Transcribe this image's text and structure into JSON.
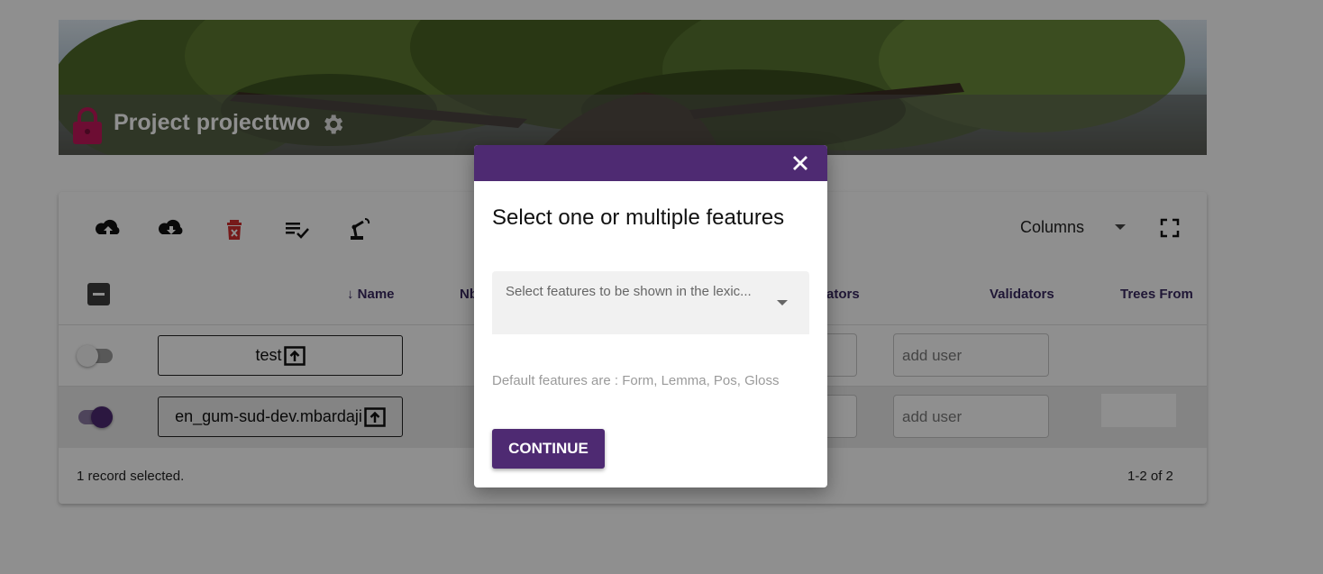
{
  "project": {
    "title": "Project projecttwo",
    "lock_icon": "lock-icon",
    "settings_icon": "gear-icon"
  },
  "toolbar": {
    "icons": [
      "cloud-upload-icon",
      "cloud-download-icon",
      "delete-icon",
      "playlist-check-icon",
      "robot-arm-icon"
    ],
    "columns_label": "Columns",
    "fullscreen_icon": "fullscreen-icon"
  },
  "table": {
    "headers": {
      "name": "Name",
      "nb": "Nb",
      "annotators_partial": "ators",
      "validators": "Validators",
      "trees_from": "Trees From"
    },
    "rows": [
      {
        "name": "test",
        "selected": false,
        "annotators_placeholder": "add user"
      },
      {
        "name": "en_gum-sud-dev.mbardaji",
        "selected": true,
        "annotators_placeholder": "add user"
      }
    ],
    "footer_selected": "1 record selected.",
    "pagination": "1-2 of 2"
  },
  "modal": {
    "title": "Select one or multiple features",
    "select_placeholder": "Select features to be shown in the lexic...",
    "default_note": "Default features are : Form, Lemma, Pos, Gloss",
    "continue_label": "CONTINUE"
  },
  "colors": {
    "accent": "#4e2a72",
    "lock": "#c2185b",
    "delete": "#d32f2f"
  }
}
